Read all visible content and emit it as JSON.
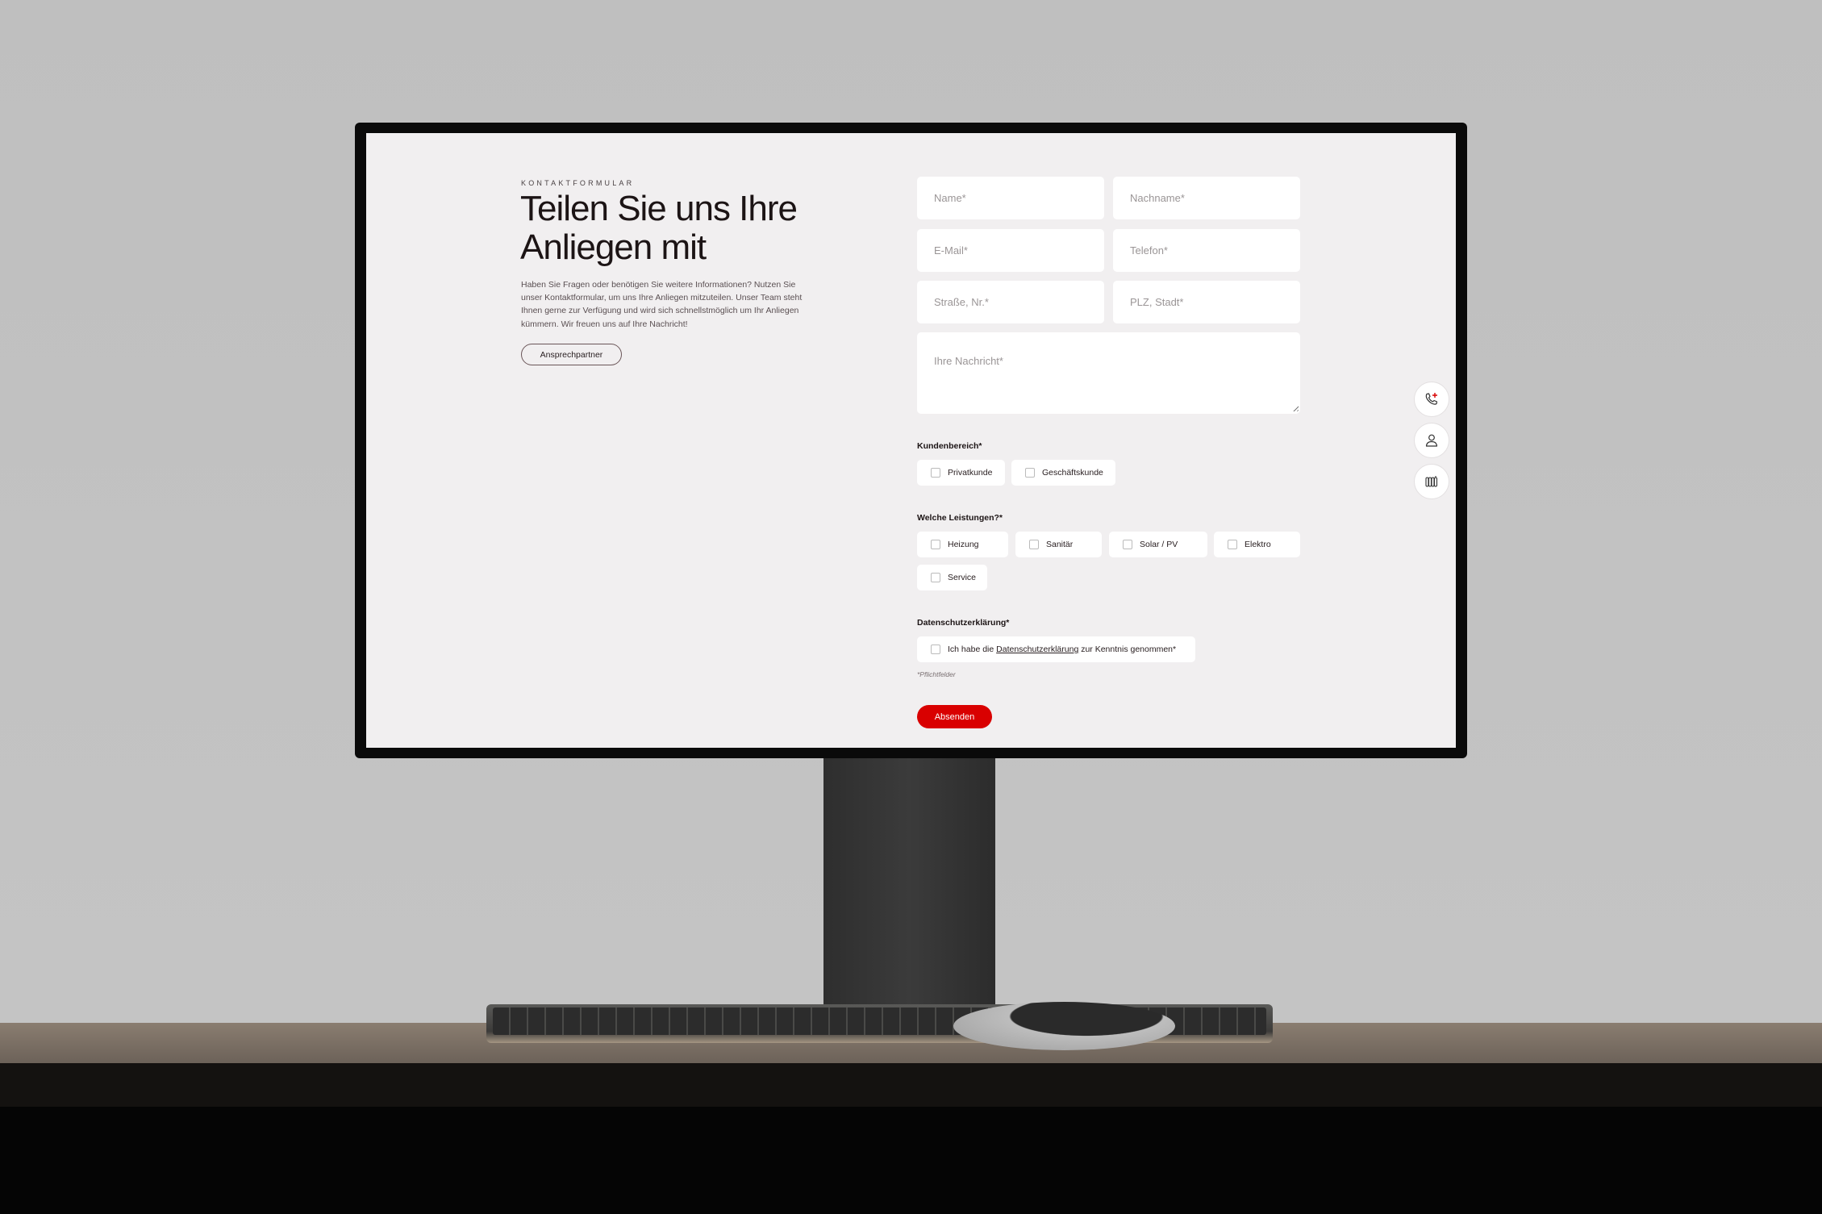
{
  "page": {
    "eyebrow": "KONTAKTFORMULAR",
    "heading": "Teilen Sie uns Ihre Anliegen mit",
    "intro": "Haben Sie Fragen oder benötigen Sie weitere Informationen? Nutzen Sie unser Kontaktformular, um uns Ihre Anliegen mitzuteilen. Unser Team steht Ihnen gerne zur Verfügung und wird sich schnellstmöglich um Ihr Anliegen kümmern. Wir freuen uns auf Ihre Nachricht!",
    "contact_button": "Ansprechpartner"
  },
  "form": {
    "fields": {
      "name": {
        "placeholder": "Name*",
        "value": ""
      },
      "lastname": {
        "placeholder": "Nachname*",
        "value": ""
      },
      "email": {
        "placeholder": "E-Mail*",
        "value": ""
      },
      "phone": {
        "placeholder": "Telefon*",
        "value": ""
      },
      "street": {
        "placeholder": "Straße, Nr.*",
        "value": ""
      },
      "city": {
        "placeholder": "PLZ, Stadt*",
        "value": ""
      },
      "message": {
        "placeholder": "Ihre Nachricht*",
        "value": ""
      }
    },
    "customer_area": {
      "label": "Kundenbereich*",
      "options": [
        "Privatkunde",
        "Geschäftskunde"
      ]
    },
    "services": {
      "label": "Welche Leistungen?*",
      "options": [
        "Heizung",
        "Sanitär",
        "Solar / PV",
        "Elektro",
        "Service"
      ]
    },
    "privacy": {
      "label": "Datenschutzerklärung*",
      "prefix": "Ich habe die",
      "link": "Datenschutzerklärung",
      "suffix": "zur Kenntnis genommen*"
    },
    "required_note": "*Pflichtfelder",
    "submit": "Absenden"
  },
  "side_buttons": [
    {
      "icon": "phone-plus-icon"
    },
    {
      "icon": "person-icon"
    },
    {
      "icon": "radiator-icon"
    }
  ],
  "colors": {
    "accent": "#d90000",
    "background": "#f1eff0",
    "text": "#1c1415"
  }
}
